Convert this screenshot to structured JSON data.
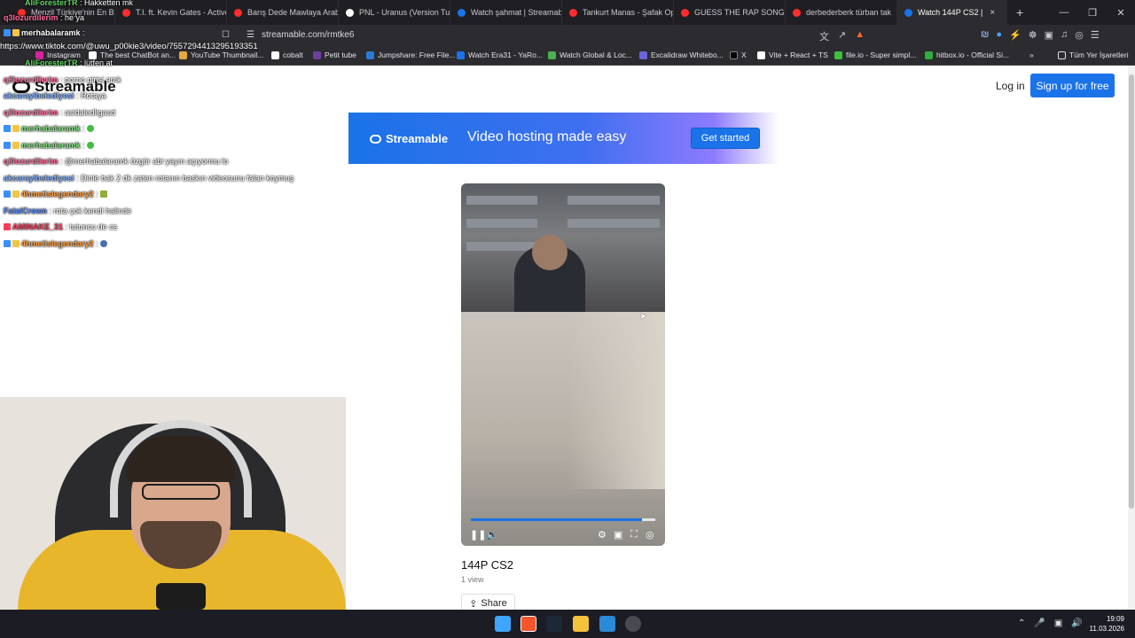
{
  "browser": {
    "tabs": [
      {
        "label": "Menzil Türkiye'nin En Büy",
        "color": "#ff2d2d"
      },
      {
        "label": "T.I. ft. Kevin Gates - Active",
        "color": "#ff2d2d"
      },
      {
        "label": "Barış Dede Mawlaya Arab",
        "color": "#ff2d2d"
      },
      {
        "label": "PNL - Uranus (Version Tun",
        "color": "#ffffff"
      },
      {
        "label": "Watch şahmat | Streamab",
        "color": "#1a73e8"
      },
      {
        "label": "Tankurt Manas - Şafak Op",
        "color": "#ff2d2d"
      },
      {
        "label": "GUESS THE RAP SONG - M",
        "color": "#ff2d2d"
      },
      {
        "label": "derbederberk türban tak",
        "color": "#ff2d2d"
      },
      {
        "label": "Watch 144P CS2 |",
        "color": "#1a73e8"
      }
    ],
    "active_tab_close": "×",
    "new_tab": "+",
    "url": "streamable.com/rmtke6",
    "bookmarks": [
      {
        "label": "Instagram",
        "color": "#d6249f"
      },
      {
        "label": "The best ChatBot an...",
        "color": "#ffffff"
      },
      {
        "label": "YouTube Thumbnail...",
        "color": "#e7a93c"
      },
      {
        "label": "cobalt",
        "color": "#ffffff"
      },
      {
        "label": "Petit tube",
        "color": "#6b3fa0"
      },
      {
        "label": "Jumpshare: Free File...",
        "color": "#2a7bd9"
      },
      {
        "label": "Watch Era31 - YaRo...",
        "color": "#1a73e8"
      },
      {
        "label": "Watch Global & Loc...",
        "color": "#4caf50"
      },
      {
        "label": "Excalidraw Whitebo...",
        "color": "#6965db"
      },
      {
        "label": "X",
        "color": "#000000"
      },
      {
        "label": "Vite + React + TS",
        "color": "#ffffff"
      },
      {
        "label": "file.io - Super simpl...",
        "color": "#3fbf3f"
      },
      {
        "label": "hitbox.io - Official Si...",
        "color": "#2fae3c"
      }
    ],
    "all_bookmarks": "Tüm Yer İşaretleri",
    "more_bookmarks": "»"
  },
  "site": {
    "logo": "Streamable",
    "login": "Log in",
    "signup": "Sign up for free",
    "banner": {
      "logo": "Streamable",
      "tagline": "Video hosting made easy",
      "cta": "Get started"
    },
    "video": {
      "title": "144P CS2",
      "views": "1 view",
      "share": "Share",
      "progress": 0.93
    }
  },
  "overlay": {
    "link": "https://www.tiktok.com/@uwu_p00kie3/video/7557294413295193351",
    "chat": [
      {
        "user": "AliForesterTR",
        "msg": "Hakketten mk",
        "color": "#5fd65f"
      },
      {
        "user": "q3lozurdilerim",
        "msg": "he ya",
        "color": "#ff6b9a"
      },
      {
        "user": "merhabalaramk",
        "msg": "",
        "color": "#ffffff"
      },
      {
        "user": "AliForesterTR",
        "msg": "lütfen at",
        "color": "#5fd65f"
      },
      {
        "user": "q3lozurdilerim",
        "msg": "porno girişi amk",
        "color": "#ff6b9a"
      },
      {
        "user": "akcarayibelediyesi",
        "msg": "Rotaya",
        "color": "#7fb0ff"
      },
      {
        "user": "q3lozurdilerim",
        "msg": "asidaledligasd",
        "color": "#ff6b9a"
      },
      {
        "user": "merhabalaramk",
        "msg": "",
        "color": "#7fe07f"
      },
      {
        "user": "merhabalaramk",
        "msg": "",
        "color": "#7fe07f"
      },
      {
        "user": "q3lozurdilerim",
        "msg": "@merhabalaramk özgür abi yayın açıyormu lo",
        "color": "#ff6b9a"
      },
      {
        "user": "akcarayibelediyesi",
        "msg": "Dinle bak 2 dk zaten rotanın baskın videosunu falan koymuş",
        "color": "#7fb0ff"
      },
      {
        "user": "4hmetislegendary2",
        "msg": "",
        "color": "#ff9f3f"
      },
      {
        "user": "FatalCrown",
        "msg": "rota çok kendi halinde",
        "color": "#5b8cff"
      },
      {
        "user": "AMINAKE_31",
        "msg": "tutuncu de cs",
        "color": "#ff3b5c"
      },
      {
        "user": "4hmetislegendary2",
        "msg": "",
        "color": "#ff9f3f"
      }
    ]
  },
  "taskbar": {
    "time": "19:09",
    "date": "11.03.2026"
  }
}
